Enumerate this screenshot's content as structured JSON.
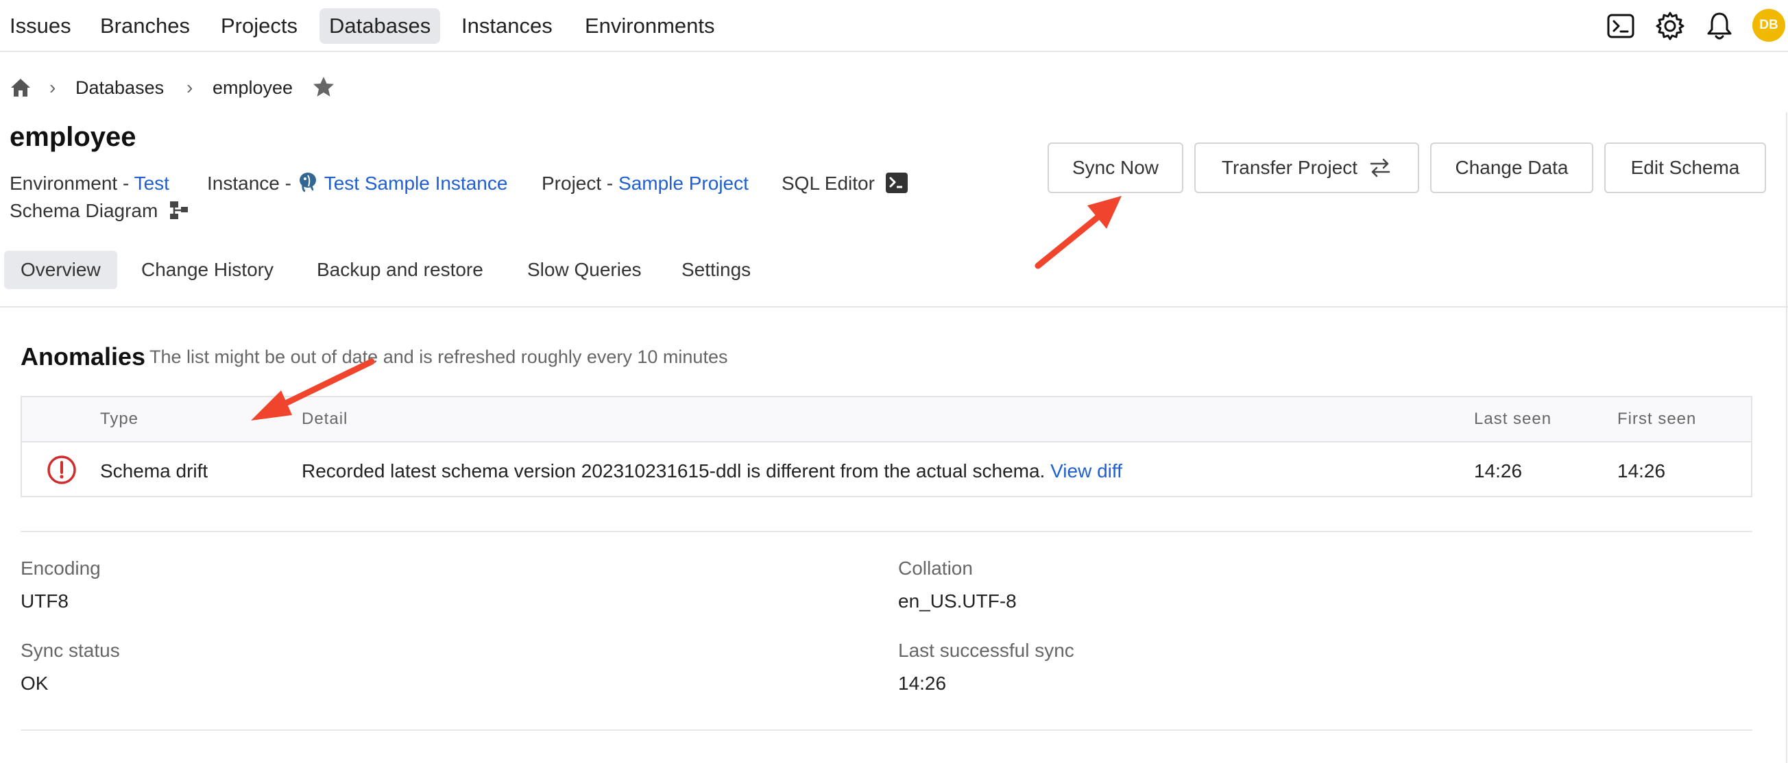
{
  "nav": {
    "items": [
      "Issues",
      "Branches",
      "Projects",
      "Databases",
      "Instances",
      "Environments"
    ],
    "active": "Databases",
    "avatar_initials": "DB",
    "icons": [
      "terminal-icon",
      "gear-icon",
      "bell-icon"
    ]
  },
  "breadcrumb": {
    "items": [
      "Databases",
      "employee"
    ]
  },
  "database": {
    "title": "employee",
    "environment_label": "Environment - ",
    "environment_value": "Test",
    "instance_label": "Instance - ",
    "instance_value": "Test Sample Instance",
    "project_label": "Project - ",
    "project_value": "Sample Project",
    "sql_editor": "SQL Editor",
    "schema_diagram": "Schema Diagram"
  },
  "actions": {
    "sync_now": "Sync Now",
    "transfer_project": "Transfer Project",
    "change_data": "Change Data",
    "edit_schema": "Edit Schema"
  },
  "tabs": [
    "Overview",
    "Change History",
    "Backup and restore",
    "Slow Queries",
    "Settings"
  ],
  "anomalies": {
    "title": "Anomalies",
    "subtitle": "The list might be out of date and is refreshed roughly every 10 minutes",
    "columns": [
      "Type",
      "Detail",
      "Last seen",
      "First seen"
    ],
    "rows": [
      {
        "type": "Schema drift",
        "detail": "Recorded latest schema version 202310231615-ddl is different from the actual schema.",
        "detail_link": "View diff",
        "last_seen": "14:26",
        "first_seen": "14:26"
      }
    ]
  },
  "info": {
    "encoding_label": "Encoding",
    "encoding_value": "UTF8",
    "collation_label": "Collation",
    "collation_value": "en_US.UTF-8",
    "sync_status_label": "Sync status",
    "sync_status_value": "OK",
    "last_sync_label": "Last successful sync",
    "last_sync_value": "14:26"
  },
  "colors": {
    "link": "#1f5fd1",
    "alert": "#d12c2c",
    "annotation_arrow": "#f0442c",
    "avatar": "#f1b800"
  }
}
